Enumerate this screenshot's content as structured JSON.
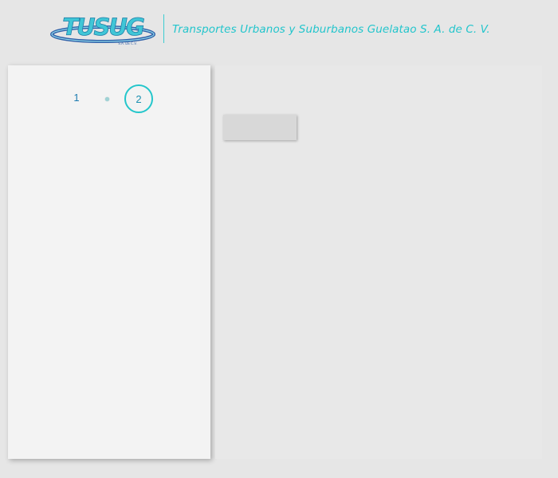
{
  "header": {
    "company_name": "Transportes Urbanos y Suburbanos Guelatao S. A. de C. V.",
    "logo_text": "TUSUG",
    "logo_subtext": "S.A. DE C.V."
  },
  "stepper": {
    "steps": [
      {
        "label": "1",
        "active": false
      },
      {
        "label": "2",
        "active": true
      }
    ]
  },
  "main": {
    "button_label": ""
  },
  "colors": {
    "accent": "#23c6cb",
    "logo_blue": "#2f5fa8",
    "background": "#e6e6e6",
    "panel": "#f3f3f3"
  }
}
